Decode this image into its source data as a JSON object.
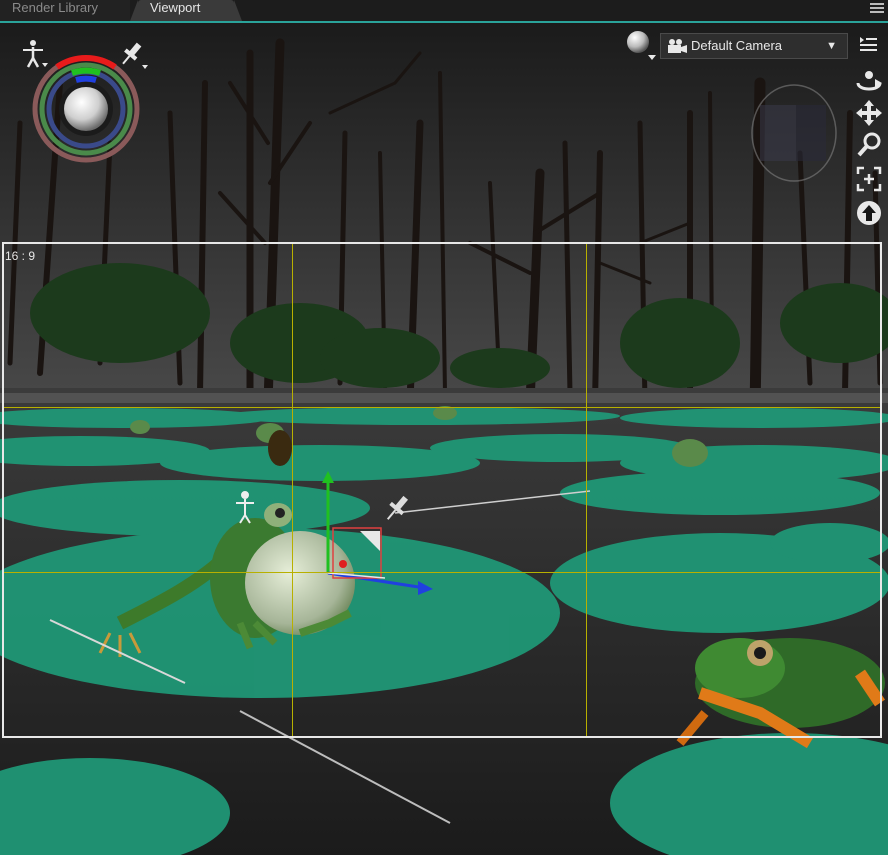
{
  "tabs": [
    {
      "label": "Render Library",
      "active": false
    },
    {
      "label": "Viewport",
      "active": true
    }
  ],
  "viewport": {
    "aspect_label": "16 : 9",
    "camera": {
      "selected": "Default Camera"
    },
    "icons": {
      "figure_selector": "figure-icon",
      "pin": "pin-icon",
      "shading": "sphere-shading-icon",
      "camera": "camera-icon",
      "orbit": "orbit-icon",
      "pan": "pan-icon",
      "zoom": "zoom-icon",
      "frame": "frame-icon",
      "up": "up-arrow-icon",
      "panel_menu": "panel-menu-icon",
      "view_cube": "view-cube-icon"
    }
  },
  "colors": {
    "accent": "#2aa39a",
    "lily_pad": "#1f9a78",
    "guide": "#b8b000",
    "frame": "#e8e8e8"
  }
}
